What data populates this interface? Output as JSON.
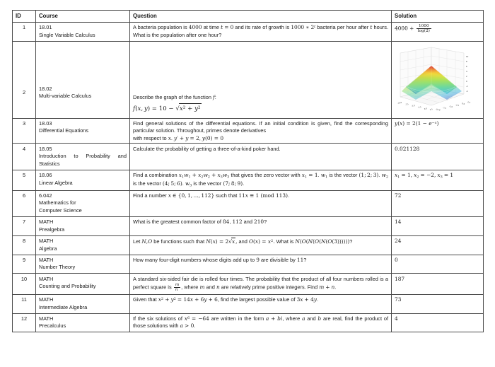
{
  "table": {
    "headers": [
      "ID",
      "Course",
      "Question",
      "Solution"
    ],
    "rows": [
      {
        "id": "1",
        "course_code": "18.01",
        "course_name": "Single Variable Calculus",
        "question_plain": "A bacteria population is 4000 at time t = 0 and its rate of growth is 1000 * 2^t bacteria per hour after t hours. What is the population after one hour?",
        "solution_plain": "4000 + 1000/log(2)"
      },
      {
        "id": "2",
        "course_code": "18.02",
        "course_name": "Multi-variable Calculus",
        "question_plain": "Describe the graph of the function f: f(x, y) = 10 - sqrt(x^2 + y^2)",
        "solution_plain": "3D surface plot of an inverted cone peaking at 10",
        "solution_is_figure": true
      },
      {
        "id": "3",
        "course_code": "18.03",
        "course_name": "Differential Equations",
        "question_plain": "Find general solutions of the differential equations. If an initial condition is given, find the corresponding particular solution. Throughout, primes denote derivatives with respect to x. y' + y = 2, y(0) = 0",
        "solution_plain": "y(x) = 2(1 - e^-x)"
      },
      {
        "id": "4",
        "course_code": "18.05",
        "course_name": "Introduction to Probability and Statistics",
        "question_plain": "Calculate the probability of getting a three-of-a-kind poker hand.",
        "solution_plain": "0.021128"
      },
      {
        "id": "5",
        "course_code": "18.06",
        "course_name": "Linear Algebra",
        "question_plain": "Find a combination x1w1 + x2w2 + x3w3 that gives the zero vector with x1 = 1. w1 is the vector (1;2;3). w2 is the vector (4;5;6). w3 is the vector (7;8;9).",
        "solution_plain": "x1 = 1, x2 = -2, x3 = 1"
      },
      {
        "id": "6",
        "course_code": "6.042",
        "course_name": "Mathematics for Computer Science",
        "question_plain": "Find a number x in {0, 1, ..., 112} such that 11x = 1 (mod 113).",
        "solution_plain": "72"
      },
      {
        "id": "7",
        "course_code": "MATH",
        "course_name": "Prealgebra",
        "question_plain": "What is the greatest common factor of 84, 112 and 210?",
        "solution_plain": "14"
      },
      {
        "id": "8",
        "course_code": "MATH",
        "course_name": "Algebra",
        "question_plain": "Let N, O be functions such that N(x) = 2 sqrt(x), and O(x) = x^2. What is N(O(N(O(N(O(3))))))?",
        "solution_plain": "24"
      },
      {
        "id": "9",
        "course_code": "MATH",
        "course_name": "Number Theory",
        "question_plain": "How many four-digit numbers whose digits add up to 9 are divisible by 11?",
        "solution_plain": "0"
      },
      {
        "id": "10",
        "course_code": "MATH",
        "course_name": "Counting and Probability",
        "question_plain": "A standard six-sided fair die is rolled four times. The probability that the product of all four numbers rolled is a perfect square is m/n, where m and n are relatively prime positive integers. Find m + n.",
        "solution_plain": "187"
      },
      {
        "id": "11",
        "course_code": "MATH",
        "course_name": "Intermediate Algebra",
        "question_plain": "Given that x^2 + y^2 = 14x + 6y + 6, find the largest possible value of 3x + 4y.",
        "solution_plain": "73"
      },
      {
        "id": "12",
        "course_code": "MATH",
        "course_name": "Precalculus",
        "question_plain": "If the six solutions of x^6 = -64 are written in the form a + bi, where a and b are real, find the product of those solutions with a > 0.",
        "solution_plain": "4"
      }
    ]
  },
  "figure": {
    "type": "surface3d",
    "name": "cone-surface-plot",
    "description": "3D surface plot of f(x,y) = 10 - sqrt(x^2 + y^2)",
    "z_ticks": [
      "10",
      "8",
      "6",
      "4",
      "2",
      "0",
      "-2",
      "-4"
    ],
    "x_ticks": [
      "-10.0",
      "-7.5",
      "-5.0",
      "-2.5",
      "0.0",
      "2.5",
      "5.0",
      "7.5",
      "10.0"
    ],
    "y_ticks": [
      "-10.0",
      "-7.5",
      "-5.0",
      "-2.5",
      "0.0",
      "2.5",
      "5.0",
      "7.5",
      "10.0"
    ],
    "colormap": [
      "#3b4cc0",
      "#4dc8e8",
      "#63d8a4",
      "#9fe05a",
      "#f2e23a",
      "#f0903a",
      "#d6342c"
    ]
  },
  "colors": {
    "page_background": "#ffffff",
    "border": "#4a4a4a",
    "text": "#1a1a1a"
  }
}
